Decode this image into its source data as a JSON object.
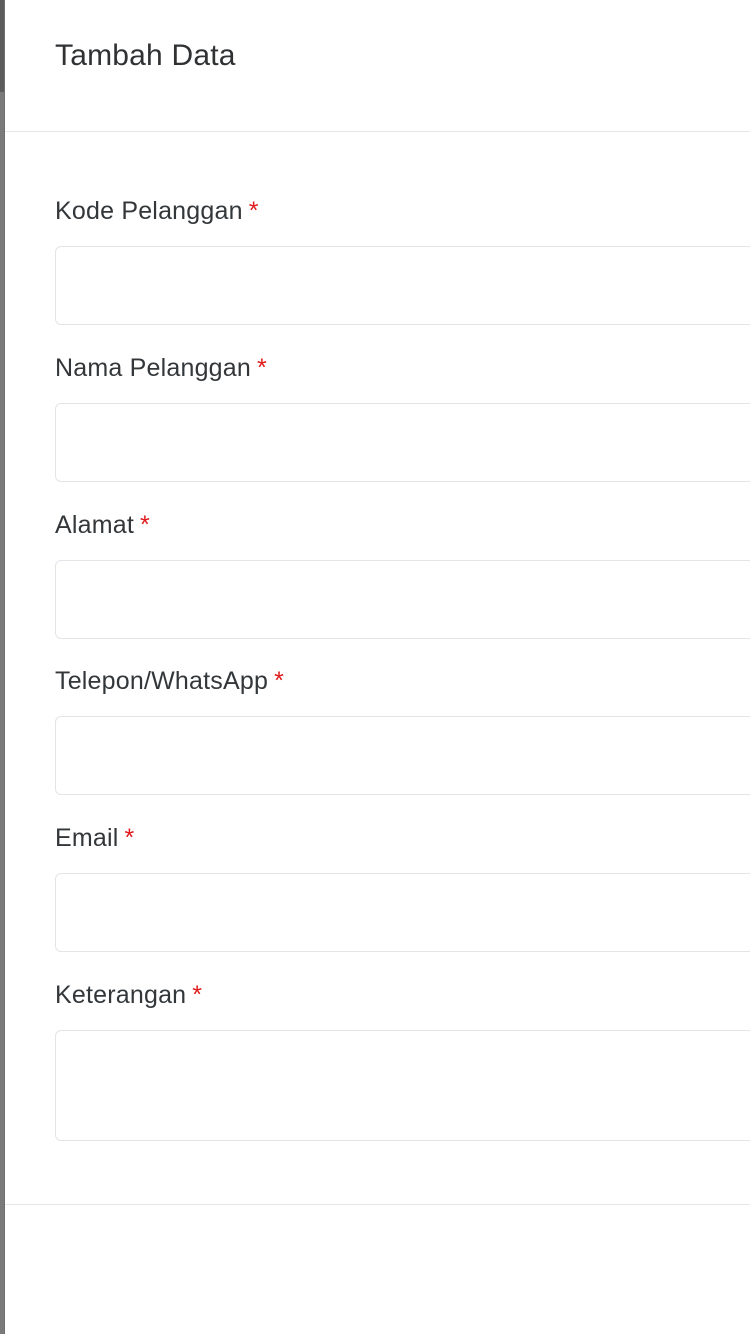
{
  "modal": {
    "title": "Tambah Data"
  },
  "form": {
    "required_mark": "*",
    "fields": [
      {
        "label": "Kode Pelanggan",
        "value": "",
        "placeholder": ""
      },
      {
        "label": "Nama Pelanggan",
        "value": "",
        "placeholder": ""
      },
      {
        "label": "Alamat",
        "value": "",
        "placeholder": ""
      },
      {
        "label": "Telepon/WhatsApp",
        "value": "",
        "placeholder": ""
      },
      {
        "label": "Email",
        "value": "",
        "placeholder": ""
      },
      {
        "label": "Keterangan",
        "value": "",
        "placeholder": ""
      }
    ]
  },
  "colors": {
    "required": "#e11b1b",
    "backdrop": "#6f6f6f"
  }
}
